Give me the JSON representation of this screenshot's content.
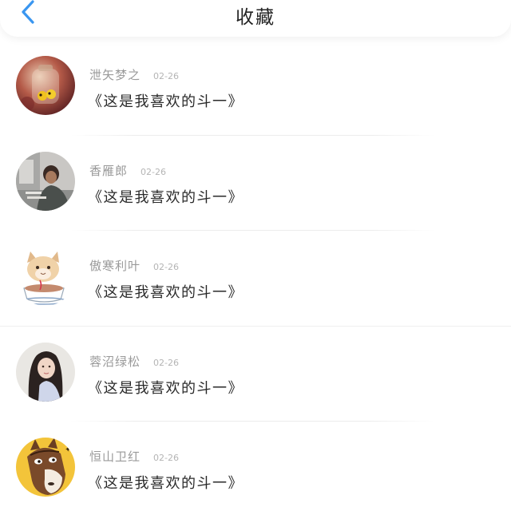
{
  "header": {
    "title": "收藏",
    "back_icon": "chevron-left-icon",
    "accent_color": "#3a96f0"
  },
  "favorites": [
    {
      "username": "泄矢梦之",
      "date": "02-26",
      "message": "《这是我喜欢的斗一》",
      "avatar": "avatar-jar-photo"
    },
    {
      "username": "香雁郎",
      "date": "02-26",
      "message": "《这是我喜欢的斗一》",
      "avatar": "avatar-person-photo"
    },
    {
      "username": "傲寒利叶",
      "date": "02-26",
      "message": "《这是我喜欢的斗一》",
      "avatar": "avatar-cat-teacup"
    },
    {
      "username": "蓉沼绿松",
      "date": "02-26",
      "message": "《这是我喜欢的斗一》",
      "avatar": "avatar-girl-photo"
    },
    {
      "username": "恒山卫红",
      "date": "02-26",
      "message": "《这是我喜欢的斗一》",
      "avatar": "avatar-cartoon-horse"
    }
  ]
}
